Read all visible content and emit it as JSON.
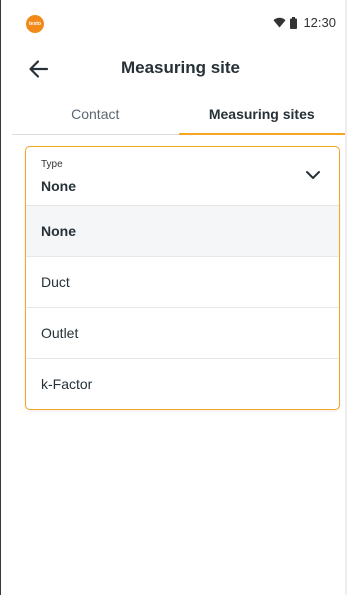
{
  "status_bar": {
    "logo_text": "testo",
    "time": "12:30",
    "icons": [
      "wifi-icon",
      "battery-icon"
    ]
  },
  "app_bar": {
    "title": "Measuring site",
    "back_icon": "arrow-left-icon"
  },
  "tabs": [
    {
      "label": "Contact",
      "active": false
    },
    {
      "label": "Measuring sites",
      "active": true
    }
  ],
  "dropdown": {
    "label": "Type",
    "value": "None",
    "chevron_icon": "chevron-down-icon",
    "options": [
      {
        "label": "None",
        "selected": true
      },
      {
        "label": "Duct",
        "selected": false
      },
      {
        "label": "Outlet",
        "selected": false
      },
      {
        "label": "k-Factor",
        "selected": false
      }
    ]
  },
  "colors": {
    "accent": "#f5a623",
    "logo": "#f28a1b",
    "text": "#263238"
  }
}
